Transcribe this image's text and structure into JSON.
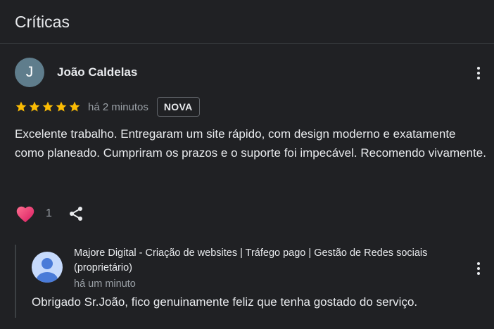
{
  "section": {
    "title": "Críticas"
  },
  "review": {
    "avatar_initial": "J",
    "reviewer_name": "João Caldelas",
    "rating": 5,
    "time": "há 2 minutos",
    "badge": "NOVA",
    "text": "Excelente trabalho. Entregaram um site rápido, com design moderno e exatamente como planeado. Cumpriram os prazos e o suporte foi impecável. Recomendo vivamente.",
    "like_count": "1"
  },
  "owner_reply": {
    "name": "Majore Digital - Criação de websites | Tráfego pago | Gestão de Redes sociais (proprietário)",
    "time": "há um minuto",
    "text": "Obrigado Sr.João, fico genuinamente feliz que tenha gostado do serviço."
  },
  "colors": {
    "background": "#202124",
    "star": "#fbbc04",
    "heart": "#e91e63",
    "avatar": "#5f7d8c",
    "owner_avatar": "#4a7bd8"
  },
  "icons": [
    "star-icon",
    "more-vert-icon",
    "heart-icon",
    "share-icon",
    "person-icon"
  ]
}
